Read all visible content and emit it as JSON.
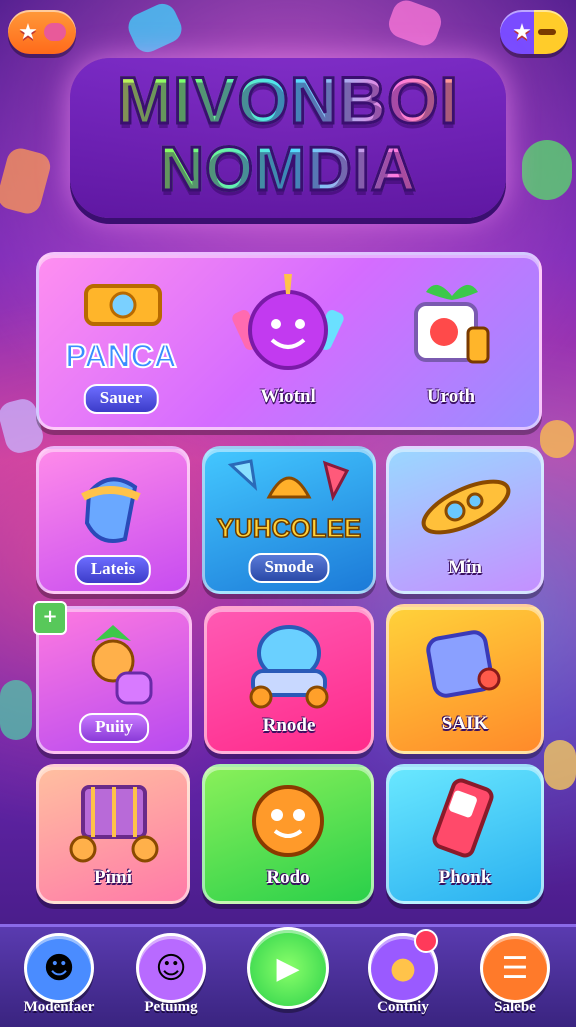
{
  "title": {
    "line1": "MIVONBOI",
    "line2": "NOMDIA"
  },
  "top_bar": {
    "left_icon": "star-icon",
    "right_icon": "star-icon"
  },
  "featured": [
    {
      "name": "PANCA",
      "label": "Sauer",
      "icon": "ticket-icon"
    },
    {
      "label": "Wiotnl",
      "icon": "bomb-icon"
    },
    {
      "label": "Uroth",
      "icon": "gift-box-icon"
    }
  ],
  "row2": [
    {
      "label": "Lateis",
      "icon": "blue-gem-icon"
    },
    {
      "name": "YUHCOLEE",
      "label": "Smode",
      "icon": "treasure-icon"
    },
    {
      "label": "Min",
      "icon": "spaceship-icon"
    }
  ],
  "row3": [
    {
      "label": "Puiiy",
      "icon": "fruit-icon",
      "badge_icon": "plus-badge-icon"
    },
    {
      "label": "Rnode",
      "icon": "robot-car-icon"
    },
    {
      "label": "SAIK",
      "icon": "cube-icon"
    }
  ],
  "row4": [
    {
      "label": "Pimi",
      "icon": "cart-icon"
    },
    {
      "label": "Rodo",
      "icon": "orange-blob-icon"
    },
    {
      "label": "Phonk",
      "icon": "phone-icon"
    }
  ],
  "nav": [
    {
      "label": "Modenfaer",
      "icon": "clown-icon"
    },
    {
      "label": "Petuimg",
      "icon": "character-icon"
    },
    {
      "label": "",
      "icon": "play-icon"
    },
    {
      "label": "Contniy",
      "icon": "coin-icon"
    },
    {
      "label": "Salebe",
      "icon": "menu-icon"
    }
  ],
  "colors": {
    "accent_pink": "#ff6ad5",
    "accent_blue": "#3ec3ff",
    "accent_green": "#5cf04a",
    "accent_yellow": "#ffd23a"
  }
}
